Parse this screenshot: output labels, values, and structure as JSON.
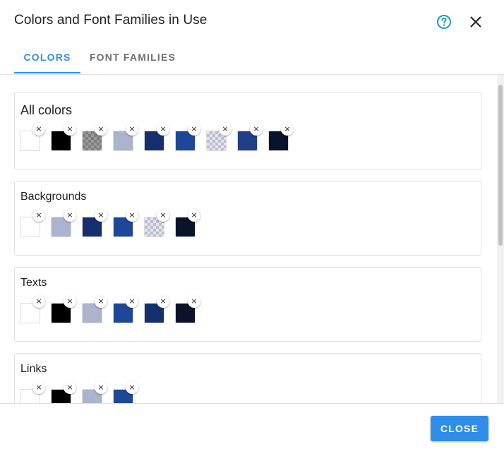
{
  "dialog": {
    "title": "Colors and Font Families in Use",
    "help_icon": "help-circle-icon",
    "close_icon": "close-icon"
  },
  "tabs": [
    {
      "label": "COLORS",
      "active": true
    },
    {
      "label": "FONT FAMILIES",
      "active": false
    }
  ],
  "accent_color": "#2f8ee8",
  "sections": {
    "all": {
      "title": "All colors",
      "swatches": [
        "#ffffff",
        "#000000",
        "checker-dark",
        "#aab4cc",
        "#16306e",
        "#1f4797",
        "checker-light",
        "#1f3f88",
        "#0b132a"
      ]
    },
    "backgrounds": {
      "title": "Backgrounds",
      "swatches": [
        "#ffffff",
        "#aab4cc",
        "#16306e",
        "#1f4797",
        "checker-light",
        "#0b132a"
      ]
    },
    "texts": {
      "title": "Texts",
      "swatches": [
        "#ffffff",
        "#000000",
        "#aab4cc",
        "#1f4797",
        "#16306e",
        "#0b132a"
      ]
    },
    "links": {
      "title": "Links",
      "swatches": [
        "#ffffff",
        "#000000",
        "#aab4cc",
        "#1f4797"
      ]
    }
  },
  "remove_glyph": "×",
  "footer": {
    "close_label": "CLOSE"
  }
}
